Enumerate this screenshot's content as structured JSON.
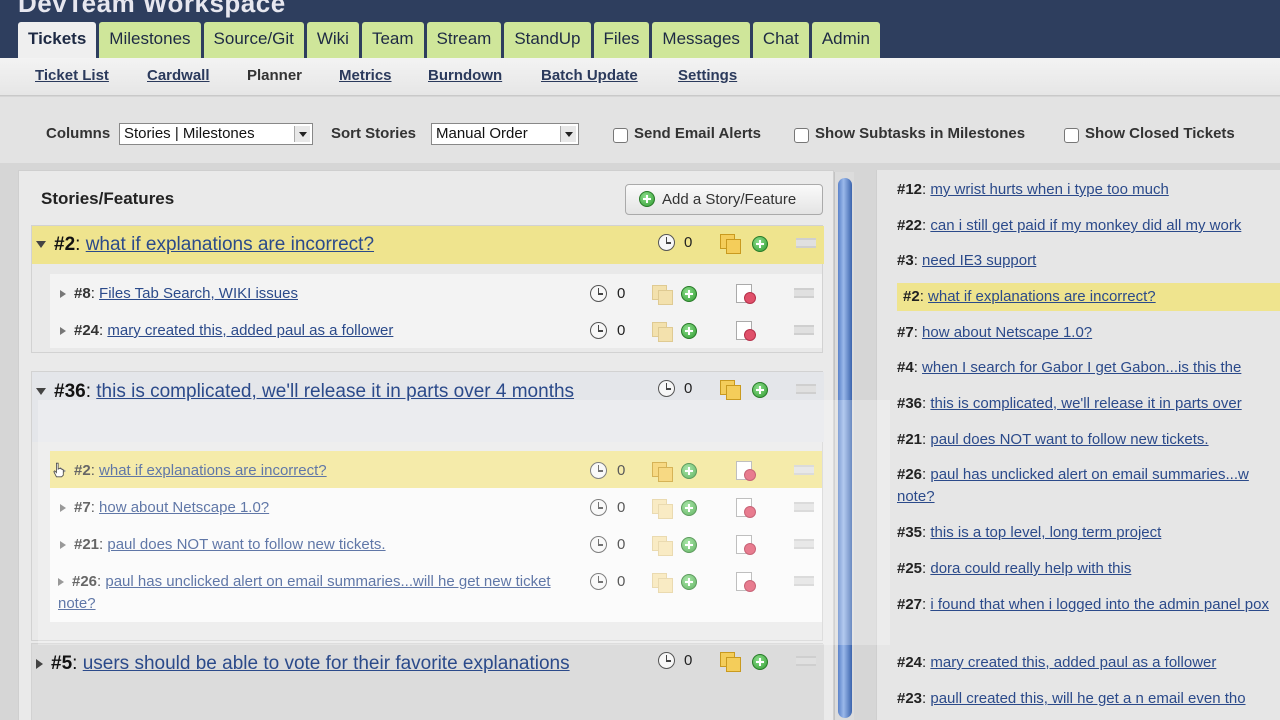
{
  "app": {
    "title": "DevTeam Workspace"
  },
  "main_tabs": [
    {
      "label": "Tickets"
    },
    {
      "label": "Milestones"
    },
    {
      "label": "Source/Git"
    },
    {
      "label": "Wiki"
    },
    {
      "label": "Team"
    },
    {
      "label": "Stream"
    },
    {
      "label": "StandUp"
    },
    {
      "label": "Files"
    },
    {
      "label": "Messages"
    },
    {
      "label": "Chat"
    },
    {
      "label": "Admin"
    }
  ],
  "sub_nav": [
    {
      "label": "Ticket List"
    },
    {
      "label": "Cardwall"
    },
    {
      "label": "Planner"
    },
    {
      "label": "Metrics"
    },
    {
      "label": "Burndown"
    },
    {
      "label": "Batch Update"
    },
    {
      "label": "Settings"
    }
  ],
  "options": {
    "columns_label": "Columns",
    "columns_value": "Stories | Milestones",
    "sort_label": "Sort Stories",
    "sort_value": "Manual Order",
    "send_email_label": "Send Email Alerts",
    "show_subtasks_label": "Show Subtasks in Milestones",
    "show_closed_label": "Show Closed Tickets"
  },
  "left_panel": {
    "title": "Stories/Features",
    "add_button": "Add a Story/Feature",
    "groups": [
      {
        "num": "#2",
        "title": "what if explanations are incorrect?",
        "count": "0",
        "children": [
          {
            "num": "#8",
            "title": "Files Tab Search, WIKI issues",
            "count": "0"
          },
          {
            "num": "#24",
            "title": "mary created this, added paul as a follower",
            "count": "0"
          }
        ]
      },
      {
        "num": "#36",
        "title": "this is complicated, we'll release it in parts over 4 months",
        "count": "0",
        "children": [
          {
            "num": "#2",
            "title": "what if explanations are incorrect?",
            "count": "0"
          },
          {
            "num": "#7",
            "title": "how about Netscape 1.0?",
            "count": "0"
          },
          {
            "num": "#21",
            "title": "paul does NOT want to follow new tickets.",
            "count": "0"
          },
          {
            "num": "#26",
            "title": "paul has unclicked alert on email summaries...will he get new ticket note?",
            "count": "0"
          }
        ]
      },
      {
        "num": "#5",
        "title": "users should be able to vote for their favorite explanations",
        "count": "0"
      }
    ]
  },
  "right_panel": {
    "items": [
      {
        "num": "#12",
        "title": "my wrist hurts when i type too much"
      },
      {
        "num": "#22",
        "title": "can i still get paid if my monkey did all my work"
      },
      {
        "num": "#3",
        "title": "need IE3 support"
      },
      {
        "num": "#2",
        "title": "what if explanations are incorrect?"
      },
      {
        "num": "#7",
        "title": "how about Netscape 1.0?"
      },
      {
        "num": "#4",
        "title": "when I search for Gabor I get Gabon...is this the"
      },
      {
        "num": "#36",
        "title": "this is complicated, we'll release it in parts over"
      },
      {
        "num": "#21",
        "title": "paul does NOT want to follow new tickets."
      },
      {
        "num": "#26",
        "title": "paul has unclicked alert on email summaries...w note?"
      },
      {
        "num": "#35",
        "title": "this is a top level, long term project"
      },
      {
        "num": "#25",
        "title": "dora could really help with this"
      },
      {
        "num": "#27",
        "title": "i found that when i logged into the admin panel pox"
      },
      {
        "num": "#24",
        "title": "mary created this, added paul as a follower"
      },
      {
        "num": "#23",
        "title": "paull created this, will he get a n email even tho"
      }
    ]
  },
  "colors": {
    "header_bg": "#2e3e5e",
    "tab_bg": "#cfe69a",
    "highlight_yellow": "#efe48e",
    "link": "#2b4a8a"
  }
}
